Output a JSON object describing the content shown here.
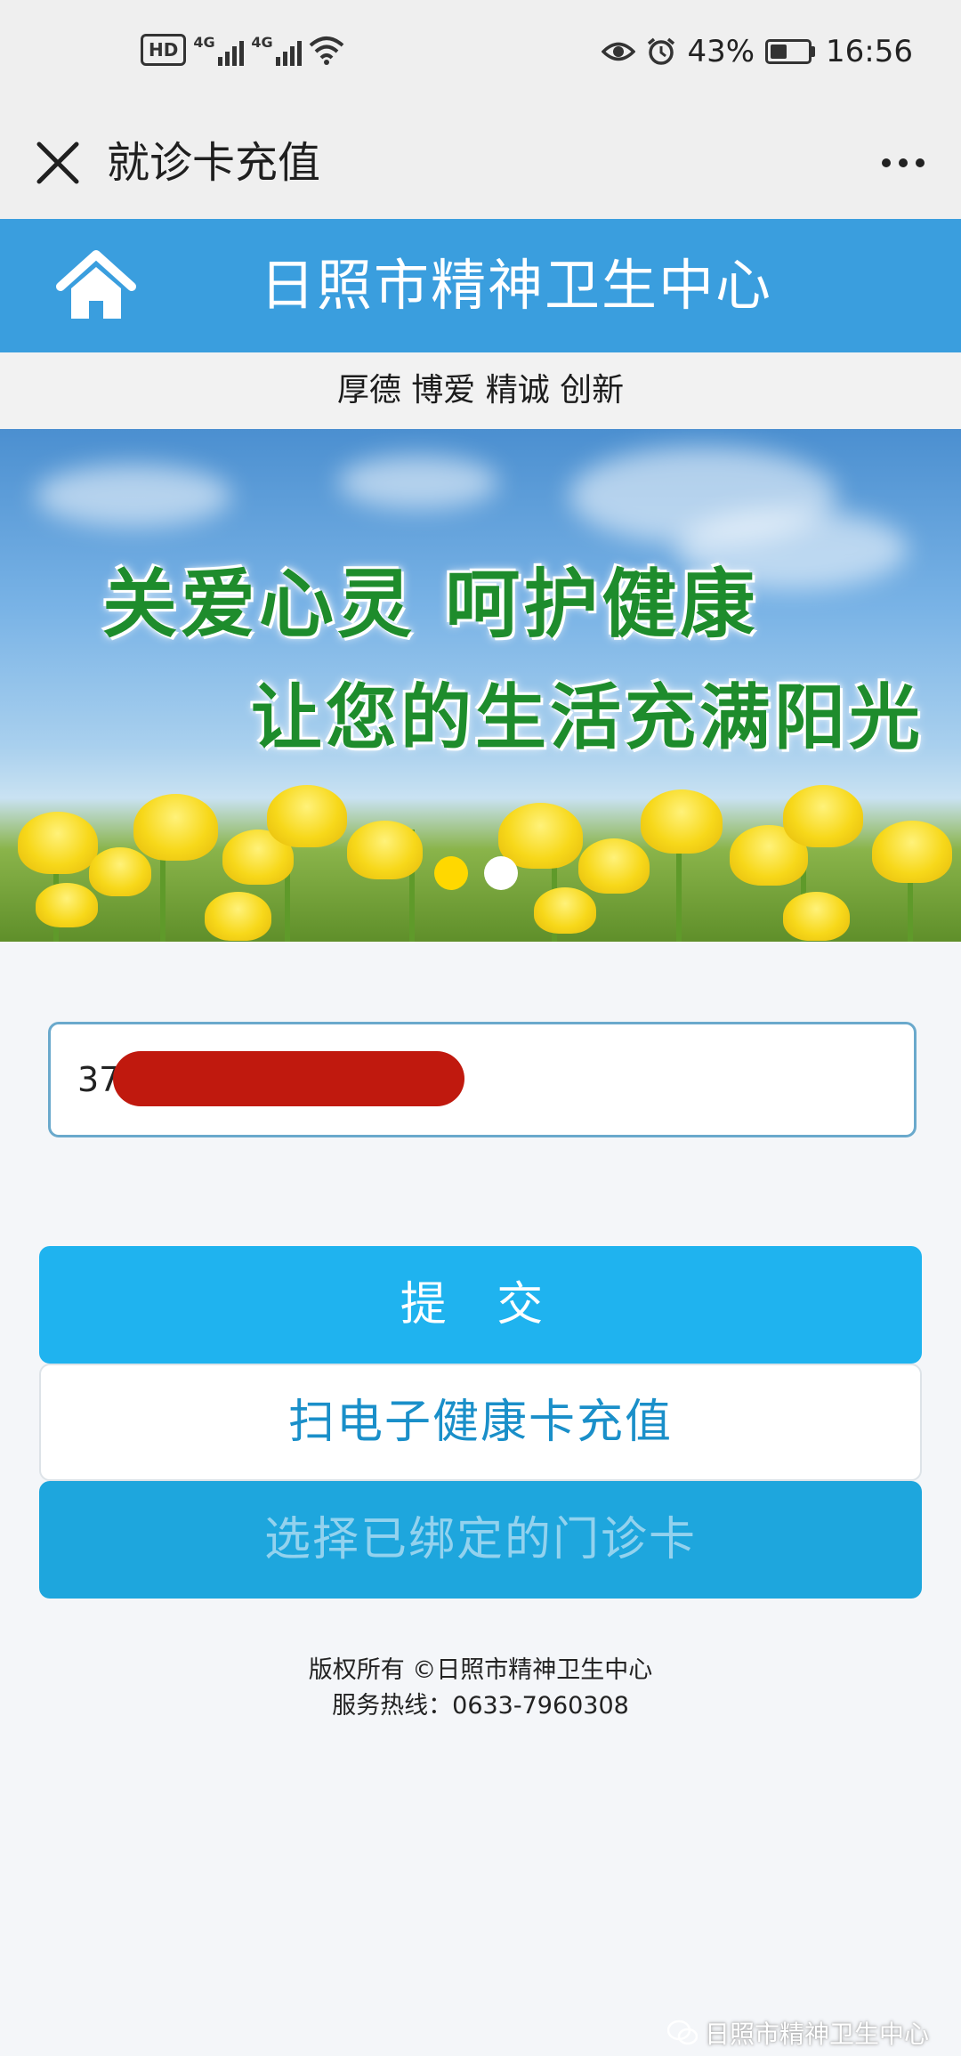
{
  "status_bar": {
    "hd_label": "HD",
    "net_labels": [
      "4G",
      "4G"
    ],
    "battery": "43%",
    "battery_level": 0.43,
    "time": "16:56"
  },
  "titlebar": {
    "title": "就诊卡充值",
    "icons": {
      "close": "close-icon",
      "more": "more-icon"
    }
  },
  "header": {
    "org_name": "日照市精神卫生中心",
    "icon": "home-icon",
    "color": "#3a9ede"
  },
  "motto": "厚德 博爱 精诚 创新",
  "banner": {
    "line1": "关爱心灵  呵护健康",
    "line2": "让您的生活充满阳光",
    "slide_count": 2,
    "active_slide": 1
  },
  "card_input": {
    "value": "37"
  },
  "buttons": {
    "submit": "提 交",
    "scan": "扫电子健康卡充值",
    "select": "选择已绑定的门诊卡"
  },
  "footer": {
    "copyright": "版权所有 ©日照市精神卫生中心",
    "hotline": "服务热线：0633-7960308"
  },
  "watermark": "日照市精神卫生中心",
  "colors": {
    "accent": "#1fb3ef",
    "link": "#1a8fc9"
  }
}
